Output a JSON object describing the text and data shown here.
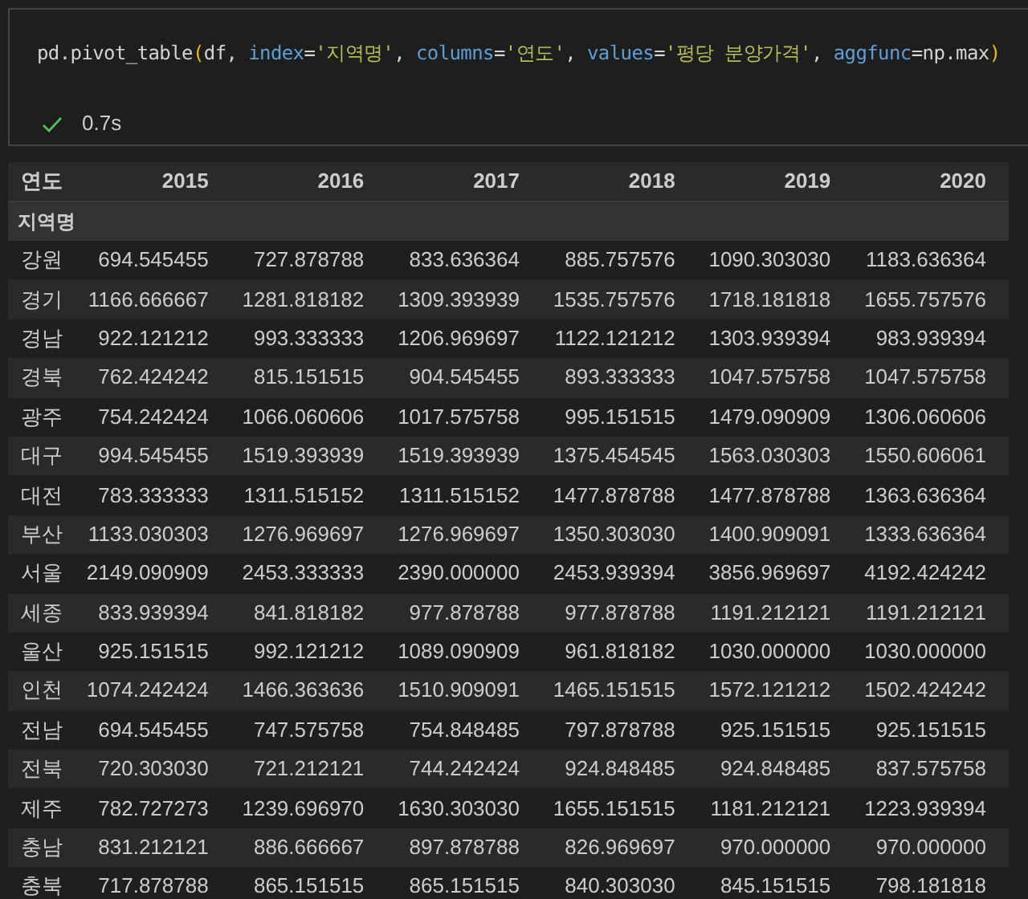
{
  "code_cell": {
    "tokens": [
      {
        "text": "pd.pivot_table",
        "kind": "plain"
      },
      {
        "text": "(",
        "kind": "paren"
      },
      {
        "text": "df, ",
        "kind": "plain"
      },
      {
        "text": "index",
        "kind": "param"
      },
      {
        "text": "=",
        "kind": "op"
      },
      {
        "text": "'지역명'",
        "kind": "string"
      },
      {
        "text": ", ",
        "kind": "plain"
      },
      {
        "text": "columns",
        "kind": "param"
      },
      {
        "text": "=",
        "kind": "op"
      },
      {
        "text": "'연도'",
        "kind": "string"
      },
      {
        "text": ", ",
        "kind": "plain"
      },
      {
        "text": "values",
        "kind": "param"
      },
      {
        "text": "=",
        "kind": "op"
      },
      {
        "text": "'평당 분양가격'",
        "kind": "string"
      },
      {
        "text": ", ",
        "kind": "plain"
      },
      {
        "text": "aggfunc",
        "kind": "param"
      },
      {
        "text": "=",
        "kind": "op"
      },
      {
        "text": "np.max",
        "kind": "plain"
      },
      {
        "text": ")",
        "kind": "paren"
      }
    ],
    "succeeded": true,
    "duration": "0.7s"
  },
  "table": {
    "columns_name": "연도",
    "index_name": "지역명",
    "columns": [
      "2015",
      "2016",
      "2017",
      "2018",
      "2019",
      "2020"
    ],
    "rows": [
      {
        "label": "강원",
        "cells": [
          "694.545455",
          "727.878788",
          "833.636364",
          "885.757576",
          "1090.303030",
          "1183.636364"
        ]
      },
      {
        "label": "경기",
        "cells": [
          "1166.666667",
          "1281.818182",
          "1309.393939",
          "1535.757576",
          "1718.181818",
          "1655.757576"
        ]
      },
      {
        "label": "경남",
        "cells": [
          "922.121212",
          "993.333333",
          "1206.969697",
          "1122.121212",
          "1303.939394",
          "983.939394"
        ]
      },
      {
        "label": "경북",
        "cells": [
          "762.424242",
          "815.151515",
          "904.545455",
          "893.333333",
          "1047.575758",
          "1047.575758"
        ]
      },
      {
        "label": "광주",
        "cells": [
          "754.242424",
          "1066.060606",
          "1017.575758",
          "995.151515",
          "1479.090909",
          "1306.060606"
        ]
      },
      {
        "label": "대구",
        "cells": [
          "994.545455",
          "1519.393939",
          "1519.393939",
          "1375.454545",
          "1563.030303",
          "1550.606061"
        ]
      },
      {
        "label": "대전",
        "cells": [
          "783.333333",
          "1311.515152",
          "1311.515152",
          "1477.878788",
          "1477.878788",
          "1363.636364"
        ]
      },
      {
        "label": "부산",
        "cells": [
          "1133.030303",
          "1276.969697",
          "1276.969697",
          "1350.303030",
          "1400.909091",
          "1333.636364"
        ]
      },
      {
        "label": "서울",
        "cells": [
          "2149.090909",
          "2453.333333",
          "2390.000000",
          "2453.939394",
          "3856.969697",
          "4192.424242"
        ]
      },
      {
        "label": "세종",
        "cells": [
          "833.939394",
          "841.818182",
          "977.878788",
          "977.878788",
          "1191.212121",
          "1191.212121"
        ]
      },
      {
        "label": "울산",
        "cells": [
          "925.151515",
          "992.121212",
          "1089.090909",
          "961.818182",
          "1030.000000",
          "1030.000000"
        ]
      },
      {
        "label": "인천",
        "cells": [
          "1074.242424",
          "1466.363636",
          "1510.909091",
          "1465.151515",
          "1572.121212",
          "1502.424242"
        ]
      },
      {
        "label": "전남",
        "cells": [
          "694.545455",
          "747.575758",
          "754.848485",
          "797.878788",
          "925.151515",
          "925.151515"
        ]
      },
      {
        "label": "전북",
        "cells": [
          "720.303030",
          "721.212121",
          "744.242424",
          "924.848485",
          "924.848485",
          "837.575758"
        ]
      },
      {
        "label": "제주",
        "cells": [
          "782.727273",
          "1239.696970",
          "1630.303030",
          "1655.151515",
          "1181.212121",
          "1223.939394"
        ]
      },
      {
        "label": "충남",
        "cells": [
          "831.212121",
          "886.666667",
          "897.878788",
          "826.969697",
          "970.000000",
          "970.000000"
        ]
      },
      {
        "label": "충북",
        "cells": [
          "717.878788",
          "865.151515",
          "865.151515",
          "840.303030",
          "845.151515",
          "798.181818"
        ]
      }
    ]
  }
}
